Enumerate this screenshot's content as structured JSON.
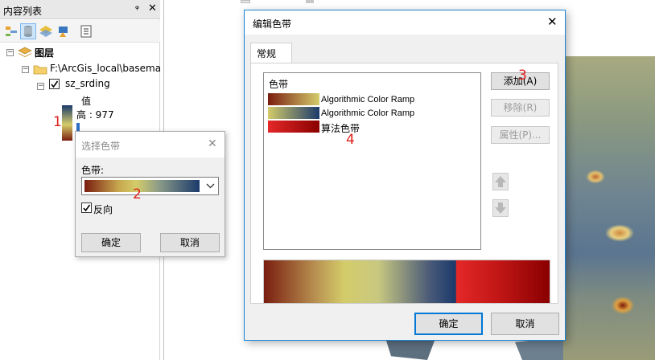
{
  "toc": {
    "title": "内容列表",
    "pin_glyph": "ᵠ",
    "close_glyph": "✕",
    "layers_label": "图层",
    "folder_label": "F:\\ArcGis_local\\basema",
    "layer_name": "sz_srding",
    "value_header": "值",
    "high_label": "高 : 977",
    "layer_checked": true
  },
  "select_dialog": {
    "title": "选择色带",
    "colorband_label": "色带:",
    "reverse_label": "反向",
    "reverse_checked": true,
    "ok_label": "确定",
    "cancel_label": "取消"
  },
  "edit_dialog": {
    "title": "编辑色带",
    "tab_label": "常规",
    "list_header": "色带",
    "ramps": [
      {
        "name": "Algorithmic Color Ramp",
        "from": "#7a1e10",
        "to": "#d4cc6a"
      },
      {
        "name": "Algorithmic Color Ramp",
        "from": "#d4cc6a",
        "to": "#1b3a6b"
      },
      {
        "name": "算法色带",
        "from": "#e52828",
        "to": "#8a0000"
      }
    ],
    "add_label": "添加(A)",
    "remove_label": "移除(R)",
    "properties_label": "属性(P)...",
    "ok_label": "确定",
    "cancel_label": "取消"
  },
  "markers": [
    "1",
    "2",
    "3",
    "4"
  ],
  "colors": {
    "ramp_dark_red": "#7a1e10",
    "ramp_tan": "#d4cc6a",
    "ramp_navy": "#1b3a6b",
    "ramp_red": "#e52828",
    "ramp_maroon": "#8a0000",
    "accent": "#0078d7",
    "marker_red": "#e0201c"
  }
}
